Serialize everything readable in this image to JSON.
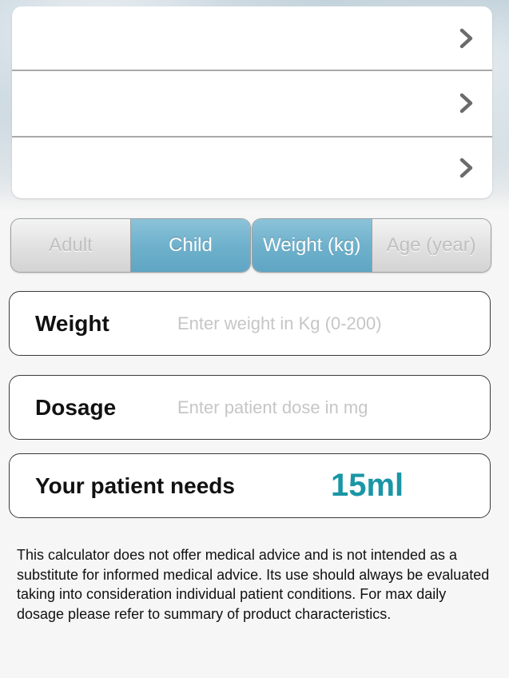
{
  "menu": {
    "rows": [
      {
        "label": "",
        "icon": "chevron-right-icon"
      },
      {
        "label": "",
        "icon": "chevron-right-icon"
      },
      {
        "label": "",
        "icon": "chevron-right-icon"
      }
    ]
  },
  "patient_type": {
    "options": [
      "Adult",
      "Child"
    ],
    "selected": "Child"
  },
  "dose_basis": {
    "options": [
      "Weight (kg)",
      "Age (year)"
    ],
    "selected": "Weight (kg)"
  },
  "weight_field": {
    "label": "Weight",
    "value": "",
    "placeholder": "Enter weight in Kg (0-200)"
  },
  "dosage_field": {
    "label": "Dosage",
    "value": "",
    "placeholder": "Enter patient dose in mg"
  },
  "result": {
    "label": "Your patient needs",
    "value": "15ml"
  },
  "disclaimer": "This calculator does not offer medical advice and is not intended as a substitute for informed medical advice. Its use should always be evaluated taking into consideration individual patient conditions. For max daily dosage please refer to summary of product characteristics.",
  "colors": {
    "accent": "#6fb1cc",
    "result_text": "#1a96a6"
  }
}
